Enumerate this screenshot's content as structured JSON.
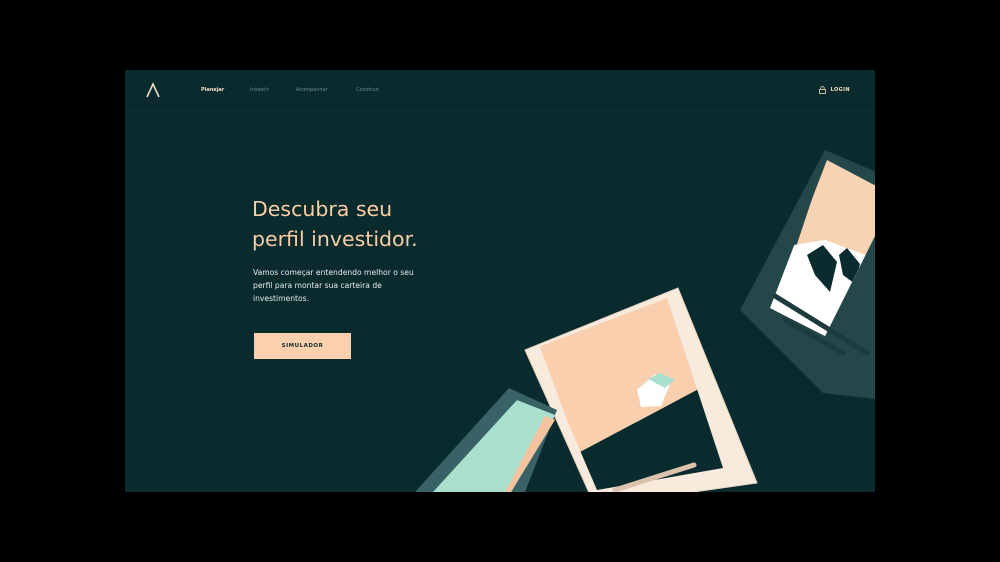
{
  "nav": {
    "logo_icon": "caret-logo-icon",
    "items": [
      {
        "label": "Planejar",
        "active": true
      },
      {
        "label": "Investir",
        "active": false
      },
      {
        "label": "Acompanhar",
        "active": false
      },
      {
        "label": "Construir",
        "active": false
      }
    ],
    "login": {
      "icon": "lock-icon",
      "label": "LOGIN"
    }
  },
  "hero": {
    "title_line1": "Descubra seu",
    "title_line2": "perfil investidor.",
    "description": "Vamos começar entendendo melhor o seu perfil para montar sua carteira de investimentos.",
    "cta_label": "SIMULADOR"
  },
  "colors": {
    "background": "#092b2d",
    "accent": "#fccfad",
    "title": "#f9cda6",
    "card_frame": "#24474a",
    "card_light": "#f8eadd",
    "mint": "#a9e0ce"
  }
}
